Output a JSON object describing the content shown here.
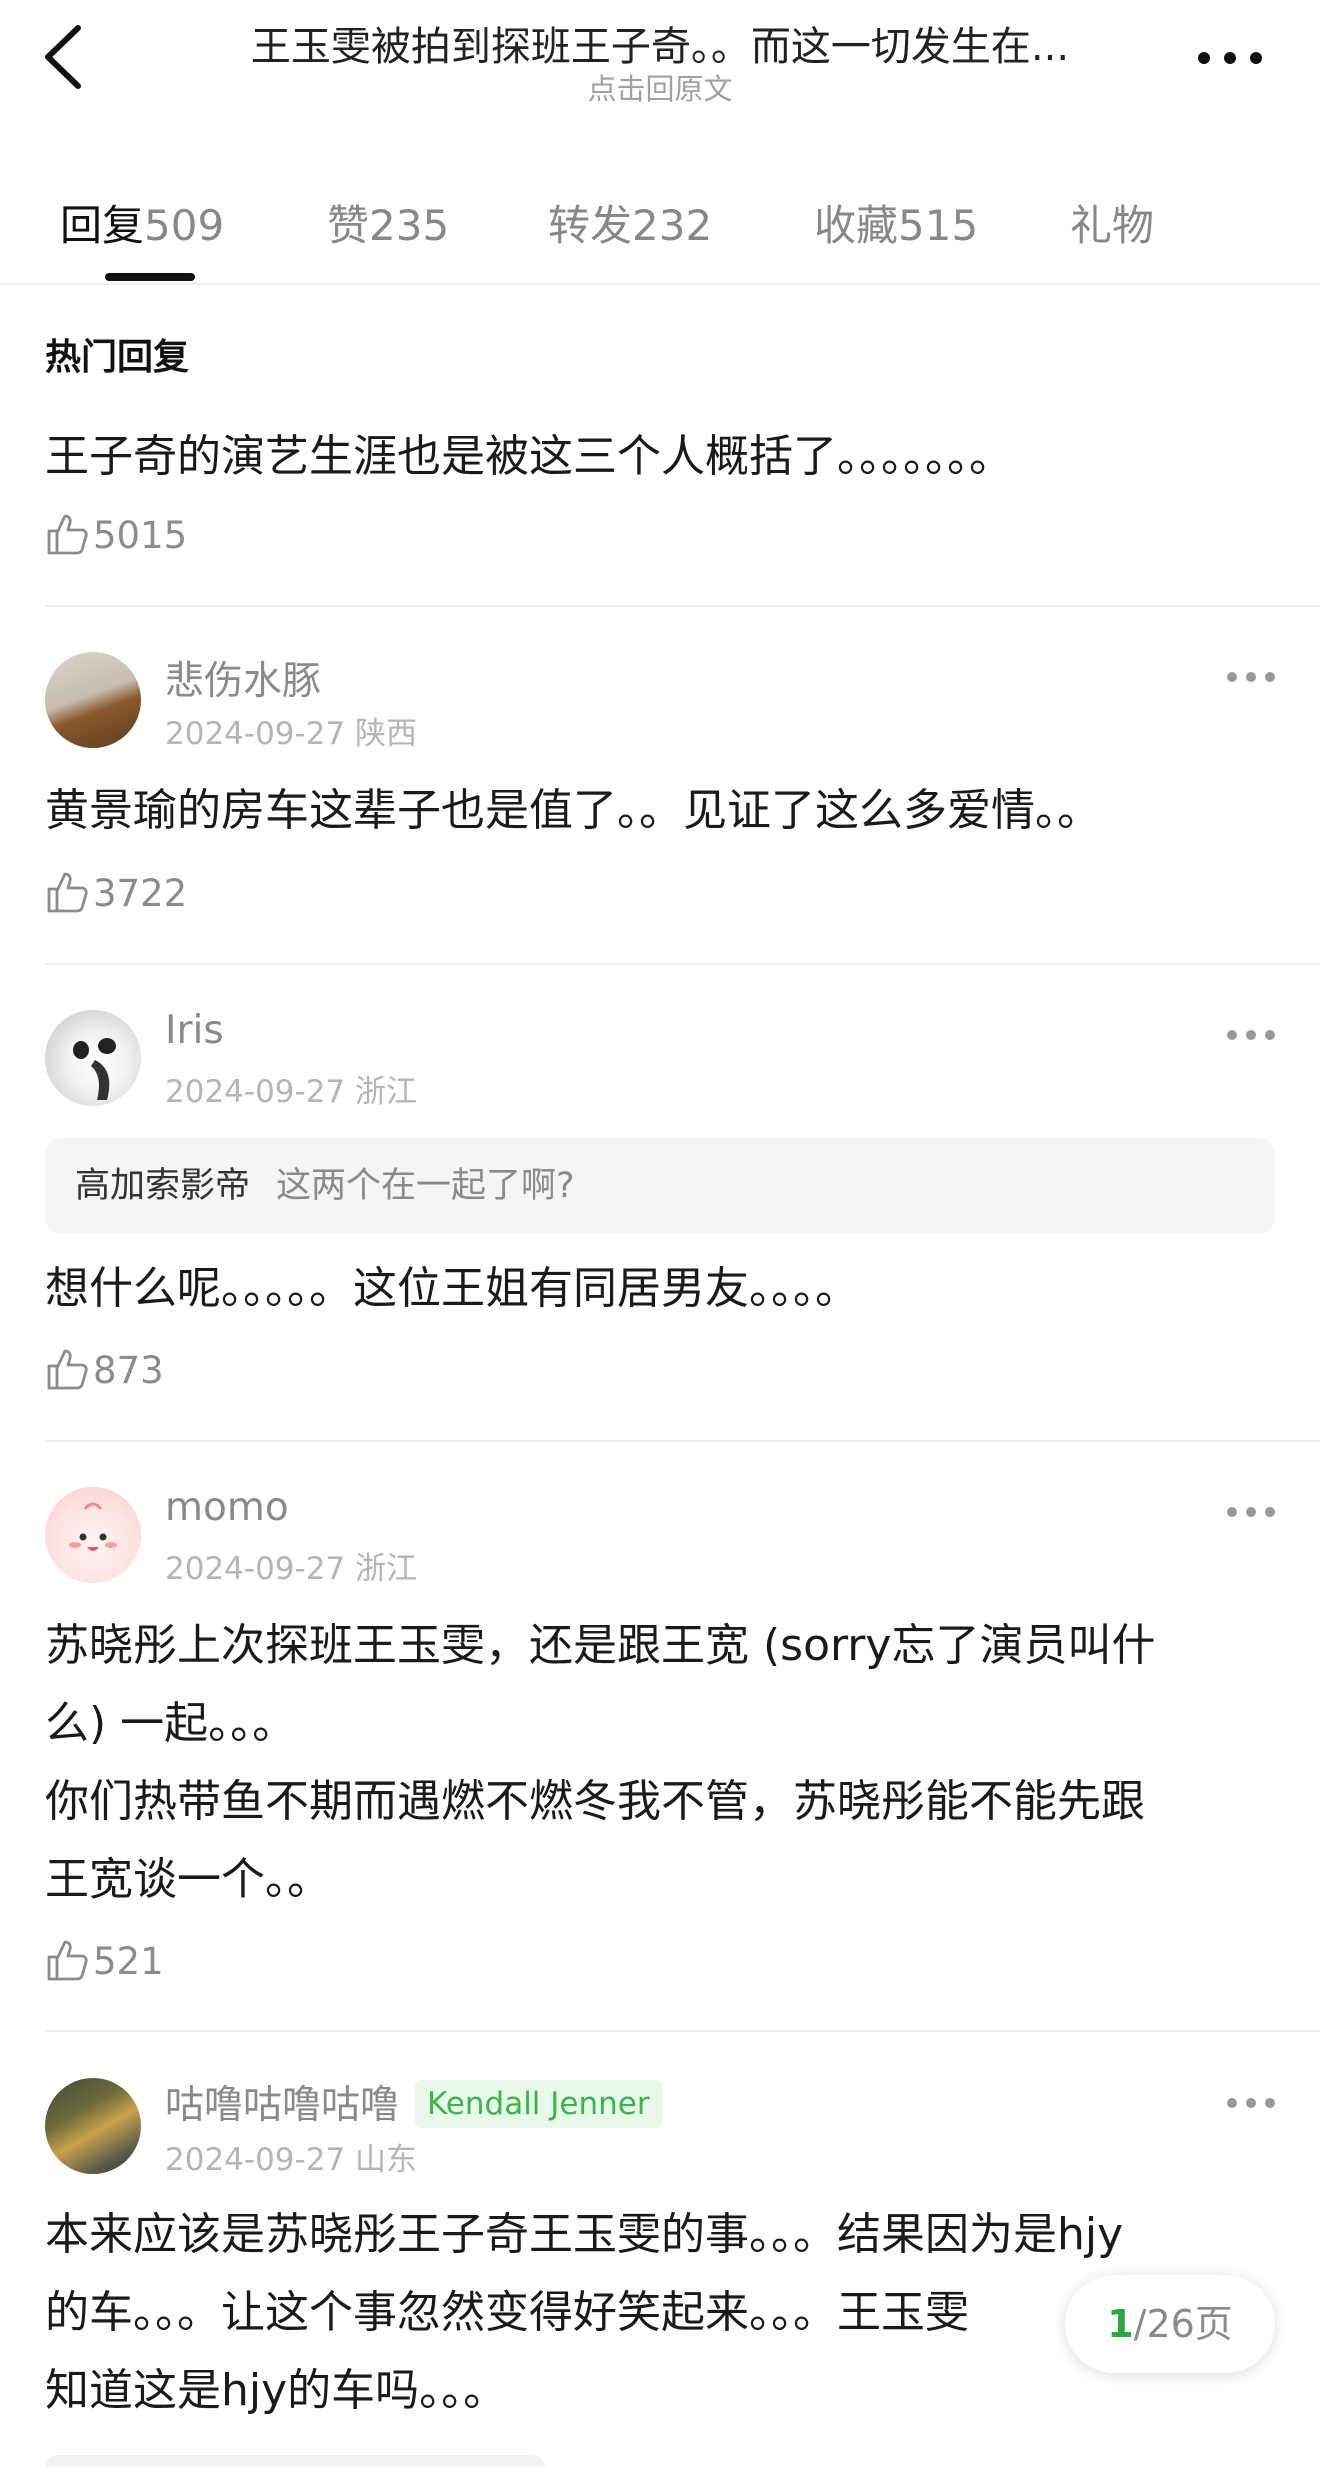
{
  "header": {
    "title": "王玉雯被拍到探班王子奇。。而这一切发生在...",
    "subtitle": "点击回原文"
  },
  "tabs": [
    {
      "name": "回复",
      "count": "509"
    },
    {
      "name": "赞",
      "count": "235"
    },
    {
      "name": "转发",
      "count": "232"
    },
    {
      "name": "收藏",
      "count": "515"
    },
    {
      "name": "礼物",
      "count": ""
    }
  ],
  "section_title": "热门回复",
  "comments": [
    {
      "lines": [
        "王子奇的演艺生涯也是被这三个人概括了。。。。。。。"
      ],
      "likes": "5015"
    },
    {
      "author": "悲伤水豚",
      "date": "2024-09-27",
      "location": "陕西",
      "lines": [
        "黄景瑜的房车这辈子也是值了。。见证了这么多爱情。。"
      ],
      "likes": "3722"
    },
    {
      "author": "Iris",
      "date": "2024-09-27",
      "location": "浙江",
      "quote_author": "高加索影帝",
      "quote_text": "这两个在一起了啊?",
      "lines": [
        "想什么呢。。。。。这位王姐有同居男友。。。。"
      ],
      "likes": "873"
    },
    {
      "author": "momo",
      "date": "2024-09-27",
      "location": "浙江",
      "lines": [
        "苏晓彤上次探班王玉雯，还是跟王宽 (sorry忘了演员叫什",
        "么) 一起。。。",
        "你们热带鱼不期而遇燃不燃冬我不管，苏晓彤能不能先跟",
        "王宽谈一个。。"
      ],
      "likes": "521"
    },
    {
      "author": "咕噜咕噜咕噜",
      "badge": "Kendall Jenner",
      "date": "2024-09-27",
      "location": "山东",
      "lines": [
        "本来应该是苏晓彤王子奇王玉雯的事。。。结果因为是hjy",
        "的车。。。让这个事忽然变得好笑起来。。。王玉雯",
        "知道这是hjy的车吗。。。"
      ]
    }
  ],
  "pager": {
    "current": "1",
    "total": "/26页"
  },
  "colors": {
    "accent_green": "#2aa848",
    "badge_green": "#3bb54a",
    "text_gray": "#8a8a8a"
  },
  "icons": [
    "back-chevron-icon",
    "more-dots-icon",
    "thumbs-up-icon"
  ]
}
